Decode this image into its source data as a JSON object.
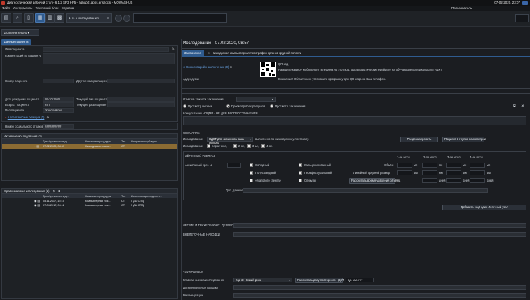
{
  "window": {
    "title": "Диагностический рабочий стол - 6.1.2 SP3 HF5 - aghub01apps.eris.local - MOWASHUB",
    "clock": "07-02-2020, 23:07"
  },
  "menu": {
    "items": [
      "Файл",
      "Инструменты",
      "Текстовый блок",
      "Справка"
    ],
    "user_label": "Пользователь"
  },
  "toolbar": {
    "study_selector": "1 из 1 исследования",
    "extra_button": "Дополнительно"
  },
  "patient": {
    "tab_label": "Данные пациента",
    "name_label": "Имя пациента",
    "comment_label": "Комментарий по пациенту",
    "number_label": "Номер пациента",
    "other_numbers_label": "Другие номера пациента",
    "dob_label": "Дата рождения пациента",
    "dob_value": "05-10-1955",
    "age_label": "Возраст пациента",
    "age_value": "64 г",
    "sex_label": "Пол пациента",
    "sex_value": "Женский пол",
    "current_type_label": "Текущий тип пациента",
    "current_location_label": "Текущее размещение пациента",
    "allergy_link": "Аллергические реакции (0)",
    "social_label": "Номер социального страхова...",
    "social_value": "##########"
  },
  "active_studies": {
    "header": "Активные исследования (1)",
    "columns": [
      "Дата/время исслед...",
      "Название процедуры",
      "Тип",
      "Направляющий врач"
    ],
    "rows": [
      {
        "date": "07-02-2020, 08:57",
        "procedure": "Низкодозная компь...",
        "type": "CT",
        "doctor": ""
      }
    ]
  },
  "compare_studies": {
    "header": "Сравниваемые исследования (2)",
    "columns": [
      "Дата/время исслед...",
      "Название процедуры",
      "Тип",
      "Исполняющее отделен..."
    ],
    "rows": [
      {
        "date": "05-11-2017, 15:15",
        "procedure": "Компьютерная том...",
        "type": "CT",
        "dept": "5 ДЦ ОПД"
      },
      {
        "date": "07-04-2017, 06:12",
        "procedure": "Компьютерная том...",
        "type": "CT",
        "dept": "5 ДЦ ОПД"
      }
    ]
  },
  "study": {
    "title": "Исследование - 07.02.2020, 08:57",
    "tabs": [
      "Заключение",
      "Низкодозная компьютерная томография органов грудной полости"
    ],
    "comment_link": "Комментарий к заключению (0)",
    "addenda_link": "Аддендумы",
    "qr_title": "QR-код",
    "qr_text1": "Наведите камеру мобильного телефона на этот код. Вы автоматически перейдете на обучающие материалы для НДКТ.",
    "qr_text2": "Внимание! Обязательно установите программу для QR-кода на Ваш телефон.",
    "urgency_label": "Отметка тяжести заключения",
    "view_options": [
      "Просмотр письма",
      "Просмотр всех разделов",
      "Просмотр заключения"
    ],
    "view_selected": 1,
    "consult_label": "Консультация НПЦМР - НЕ ДЛЯ РАСПРОСТРАНЕНИЯ",
    "desc_header": "ОПИСАНИЕ",
    "study_label": "Исследование",
    "study_select": "НДКТ для скрининга рака легкого",
    "study_protocol": "выполнено по низкодозному протоколу.",
    "randomize_btn": "Рандомизировать",
    "group_btn": "Пациент в группе волюметрии",
    "study_kinds_label": "Исследование",
    "study_kinds": [
      "первичное,",
      "2-ое,",
      "3-ье,",
      "4-ое."
    ],
    "node_header": "ЛЁГОЧНЫЙ УЗЕЛ №1",
    "axial_label": "Аксиальный срез №",
    "node_types_col1": [
      "Солидный",
      "Полусолидный",
      "«Матового стекла»"
    ],
    "node_types_col2": [
      "Кальцинированный",
      "Перифиссуральный",
      "Спикулы"
    ],
    "visit_labels": [
      "1-ое иссл.",
      "2-ое иссл.",
      "3-ое иссл.",
      "4-ое иссл."
    ],
    "volume_label": "Объём",
    "diameter_label": "Линейный средний размер",
    "unit_ml": "мл",
    "unit_mm": "мм",
    "unit_days": "дней",
    "calc_btn": "Рассчитать время удвоения объёма",
    "extra_label": "Доп. данные",
    "add_node_btn": "Добавить ещё один Лёгочный узел",
    "lungs_label": "ЛЁГКИЕ И ТРАХЕОБРОНХ. ДЕРЕВО",
    "extra_findings_label": "ВНЕЛЁГОЧНЫЕ НАХОДКИ",
    "conclusion_header": "ЗАКЛЮЧЕНИЕ",
    "assessment_label": "Главная оценка исследования",
    "assessment_value": "Код 2: Низкий риск",
    "repeat_btn": "Рассчитать дату повторного НДКТ",
    "date_placeholder": "дд. мм. гггг",
    "extra_findings2_label": "Дополнительные находки",
    "recommend_label": "Рекомендации"
  }
}
